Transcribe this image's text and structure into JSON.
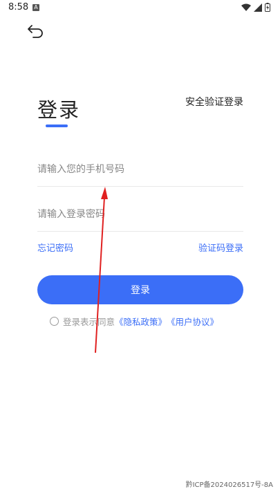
{
  "status_bar": {
    "time": "8:58",
    "badge": "A"
  },
  "header": {
    "title": "登录",
    "alt_login": "安全验证登录"
  },
  "form": {
    "phone_placeholder": "请输入您的手机号码",
    "password_placeholder": "请输入登录密码",
    "forgot_password": "忘记密码",
    "code_login": "验证码登录",
    "submit": "登录"
  },
  "agreement": {
    "text": "登录表示同意",
    "privacy": "《隐私政策》",
    "user": "《用户协议》"
  },
  "footer": {
    "icp": "黔ICP备2024026517号-8A"
  },
  "colors": {
    "accent": "#3b6ef7",
    "annotation": "#e02020"
  }
}
